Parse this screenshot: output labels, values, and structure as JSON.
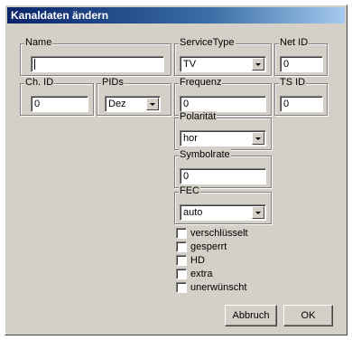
{
  "window": {
    "title": "Kanaldaten ändern"
  },
  "fields": {
    "name": {
      "label": "Name",
      "value": ""
    },
    "service_type": {
      "label": "ServiceType",
      "value": "TV"
    },
    "net_id": {
      "label": "Net ID",
      "value": "0"
    },
    "ch_id": {
      "label": "Ch. ID",
      "value": "0"
    },
    "pids": {
      "label": "PIDs",
      "value": "Dez"
    },
    "frequenz": {
      "label": "Frequenz",
      "value": "0"
    },
    "ts_id": {
      "label": "TS ID",
      "value": "0"
    },
    "polaritaet": {
      "label": "Polarität",
      "value": "hor"
    },
    "symbolrate": {
      "label": "Symbolrate",
      "value": "0"
    },
    "fec": {
      "label": "FEC",
      "value": "auto"
    }
  },
  "checkboxes": [
    {
      "label": "verschlüsselt",
      "checked": false
    },
    {
      "label": "gesperrt",
      "checked": false
    },
    {
      "label": "HD",
      "checked": false
    },
    {
      "label": "extra",
      "checked": false
    },
    {
      "label": "unerwünscht",
      "checked": false
    }
  ],
  "buttons": {
    "cancel": "Abbruch",
    "ok": "OK"
  }
}
